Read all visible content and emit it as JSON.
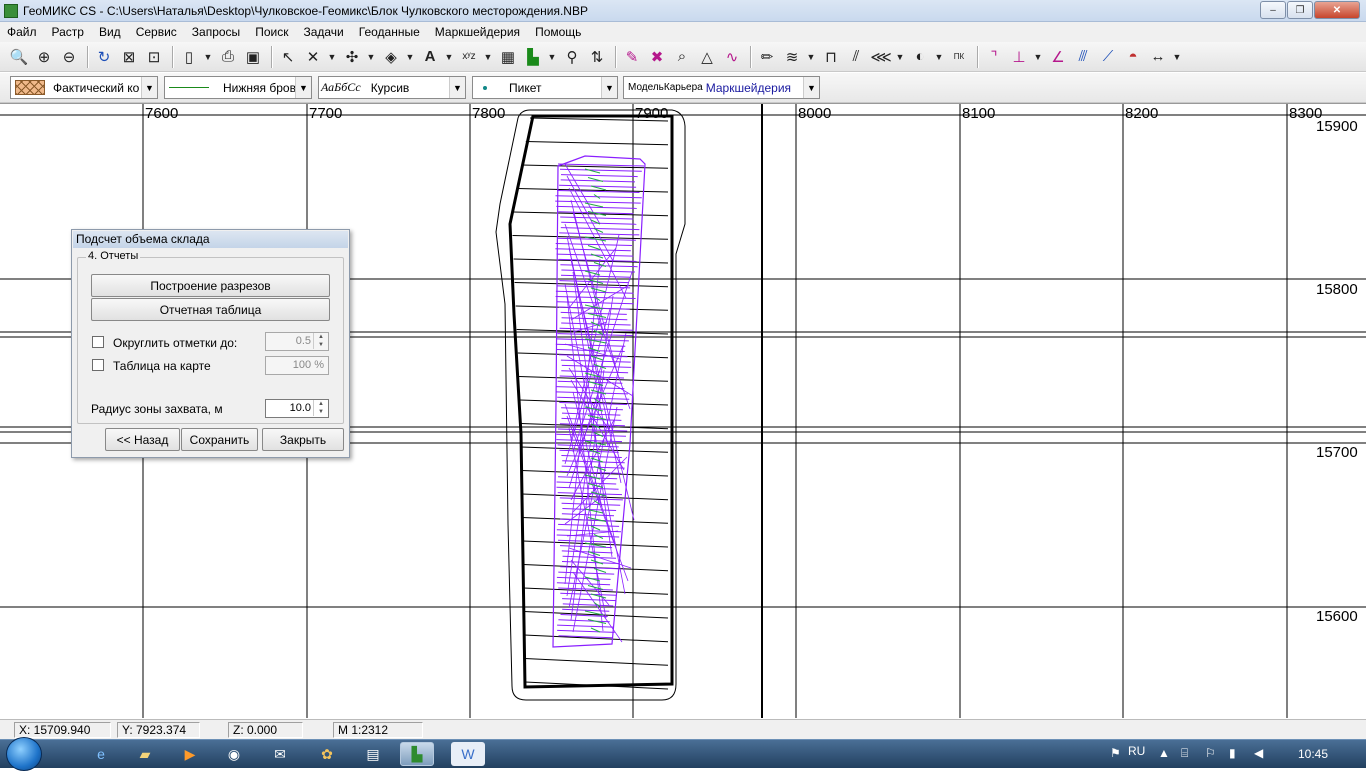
{
  "window": {
    "title": "ГеоМИКС CS - C:\\Users\\Наталья\\Desktop\\Чулковское-Геомикс\\Блок Чулковского месторождения.NBP",
    "minimize": "‒",
    "maximize": "❐",
    "close": "✕"
  },
  "menu": [
    "Файл",
    "Растр",
    "Вид",
    "Сервис",
    "Запросы",
    "Поиск",
    "Задачи",
    "Геоданные",
    "Маркшейдерия",
    "Помощь"
  ],
  "toolbar2": {
    "fill_style": "Фактический ко",
    "line_style": "Нижняя бровка",
    "font_sample": "АаБбСс",
    "font_style": "Курсив",
    "point_style": "Пикет",
    "layer_prefix": "МодельКарьера",
    "layer_name": "Маркшейдерия"
  },
  "map": {
    "x_ticks": [
      "7600",
      "7700",
      "7800",
      "7900",
      "8000",
      "8100",
      "8200",
      "8300"
    ],
    "y_ticks": [
      "15900",
      "15800",
      "15700",
      "15600"
    ],
    "colors": {
      "grid": "#000000",
      "model": "#8a1fff",
      "model_accent": "#22aa44"
    }
  },
  "dialog": {
    "title": "Подсчет объема склада",
    "group_label": "4. Отчеты",
    "btn_sections": "Построение разрезов",
    "btn_table": "Отчетная таблица",
    "round_label": "Округлить отметки до:",
    "round_value": "0.5",
    "table_on_map_label": "Таблица на карте",
    "table_on_map_value": "100 %",
    "radius_label": "Радиус зоны захвата, м",
    "radius_value": "10.0",
    "btn_back": "<< Назад",
    "btn_save": "Сохранить",
    "btn_close": "Закрыть"
  },
  "status": {
    "x": "X: 15709.940",
    "y": "Y: 7923.374",
    "z": "Z: 0.000",
    "scale": "M 1:2312"
  },
  "taskbar": {
    "language": "RU",
    "clock": "10:45"
  }
}
